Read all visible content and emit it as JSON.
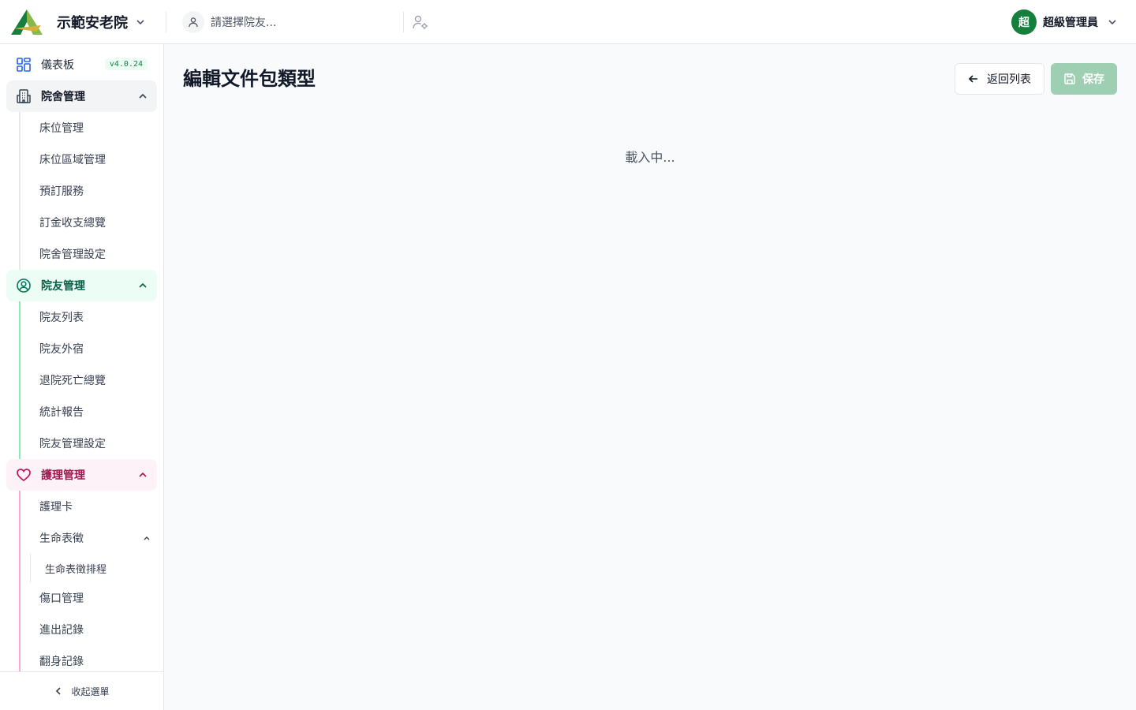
{
  "header": {
    "brand_name": "示範安老院",
    "resident_placeholder": "請選擇院友...",
    "user": {
      "avatar_char": "超",
      "name": "超級管理員"
    }
  },
  "sidebar": {
    "dashboard": {
      "label": "儀表板",
      "version": "v4.0.24"
    },
    "housing": {
      "label": "院舍管理",
      "items": [
        "床位管理",
        "床位區域管理",
        "預訂服務",
        "訂金收支總覽",
        "院舍管理設定"
      ]
    },
    "resident": {
      "label": "院友管理",
      "items": [
        "院友列表",
        "院友外宿",
        "退院死亡總覽",
        "統計報告",
        "院友管理設定"
      ]
    },
    "nursing": {
      "label": "護理管理",
      "items": {
        "care_card": "護理卡",
        "vital_signs": "生命表徵",
        "vital_signs_schedule": "生命表徵排程",
        "wound": "傷口管理",
        "in_out": "進出記錄",
        "turning": "翻身記錄"
      }
    },
    "collapse_label": "收起選單"
  },
  "main": {
    "title": "編輯文件包類型",
    "back_label": "返回列表",
    "save_label": "保存",
    "loading_text": "載入中..."
  },
  "colors": {
    "primary": "#15803d",
    "save_disabled": "#9ecfb3",
    "nursing_accent": "#be185d",
    "resident_accent": "#047857",
    "dashboard_icon": "#2563eb"
  }
}
